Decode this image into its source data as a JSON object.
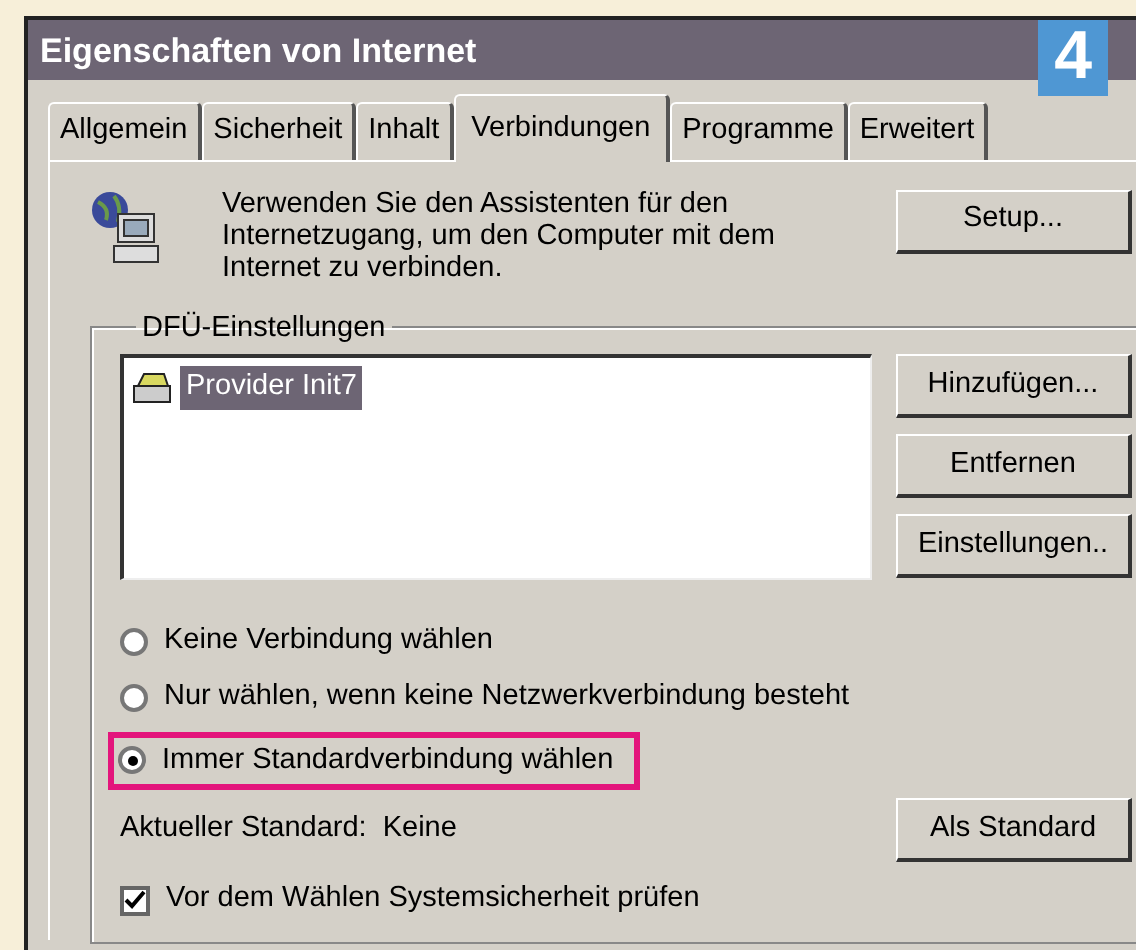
{
  "badge": "4",
  "window": {
    "title": "Eigenschaften von Internet"
  },
  "tabs": [
    {
      "label": "Allgemein",
      "selected": false
    },
    {
      "label": "Sicherheit",
      "selected": false
    },
    {
      "label": "Inhalt",
      "selected": false
    },
    {
      "label": "Verbindungen",
      "selected": true
    },
    {
      "label": "Programme",
      "selected": false
    },
    {
      "label": "Erweitert",
      "selected": false
    }
  ],
  "wizard": {
    "text": "Verwenden Sie den Assistenten für den Internetzugang, um den Computer mit dem Internet zu verbinden.",
    "button": "Setup..."
  },
  "dialup": {
    "title": "DFÜ-Einstellungen",
    "connections": [
      {
        "name": "Provider Init7",
        "selected": true
      }
    ],
    "buttons": [
      "Hinzufügen...",
      "Entfernen",
      "Einstellungen.."
    ]
  },
  "dial_options": [
    {
      "label": "Keine Verbindung wählen",
      "selected": false,
      "highlighted": false
    },
    {
      "label": "Nur wählen, wenn keine Netzwerkverbindung besteht",
      "selected": false,
      "highlighted": false
    },
    {
      "label": "Immer Standardverbindung wählen",
      "selected": true,
      "highlighted": true
    }
  ],
  "current_default": {
    "label": "Aktueller Standard:",
    "value": "Keine"
  },
  "default_button": "Als Standard",
  "security_check": {
    "label": "Vor dem Wählen Systemsicherheit prüfen",
    "checked": true
  }
}
